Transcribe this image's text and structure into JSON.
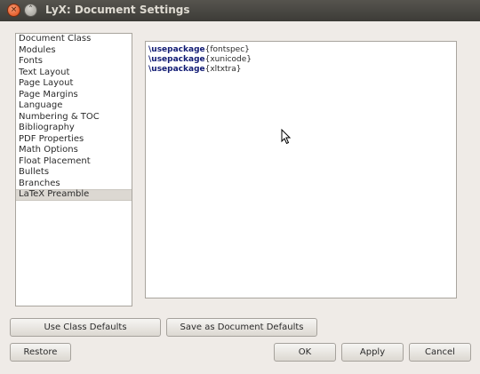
{
  "window": {
    "title": "LyX: Document Settings",
    "close_glyph": "×",
    "minimize_glyph": "˄"
  },
  "sidebar": {
    "items": [
      {
        "label": "Document Class"
      },
      {
        "label": "Modules"
      },
      {
        "label": "Fonts"
      },
      {
        "label": "Text Layout"
      },
      {
        "label": "Page Layout"
      },
      {
        "label": "Page Margins"
      },
      {
        "label": "Language"
      },
      {
        "label": "Numbering & TOC"
      },
      {
        "label": "Bibliography"
      },
      {
        "label": "PDF Properties"
      },
      {
        "label": "Math Options"
      },
      {
        "label": "Float Placement"
      },
      {
        "label": "Bullets"
      },
      {
        "label": "Branches"
      },
      {
        "label": "LaTeX Preamble"
      }
    ],
    "selected": "LaTeX Preamble"
  },
  "preamble": {
    "lines": [
      {
        "command": "\\usepackage",
        "argument": "{fontspec}"
      },
      {
        "command": "\\usepackage",
        "argument": "{xunicode}"
      },
      {
        "command": "\\usepackage",
        "argument": "{xltxtra}"
      }
    ]
  },
  "buttons": {
    "use_class_defaults": "Use Class Defaults",
    "save_as_document_defaults": "Save as Document Defaults",
    "restore": "Restore",
    "ok": "OK",
    "apply": "Apply",
    "cancel": "Cancel"
  },
  "colors": {
    "keyword": "#101a73",
    "titlebar": "#3c3b37",
    "close_button": "#df4a16"
  }
}
